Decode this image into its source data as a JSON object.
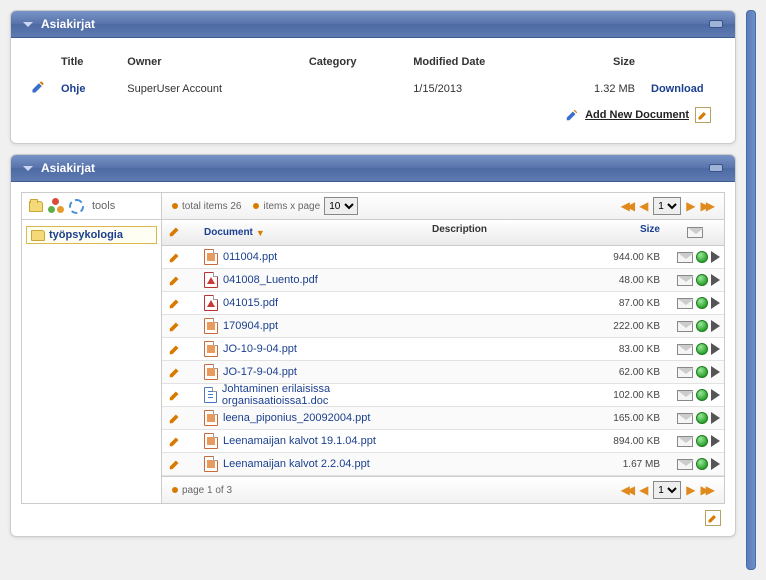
{
  "panel1": {
    "title": "Asiakirjat",
    "columns": {
      "title": "Title",
      "owner": "Owner",
      "category": "Category",
      "modified": "Modified Date",
      "size": "Size"
    },
    "row": {
      "title": "Ohje",
      "owner": "SuperUser Account",
      "category": "",
      "modified": "1/15/2013",
      "size": "1.32 MB",
      "download": "Download"
    },
    "add_new": "Add New Document"
  },
  "panel2": {
    "title": "Asiakirjat",
    "tools_label": "tools",
    "total_items": "total items  26",
    "items_per_page": "items x page",
    "page_size": "10",
    "tree_item": "työpsykologia",
    "headers": {
      "document": "Document",
      "description": "Description",
      "size": "Size"
    },
    "files": [
      {
        "name": "011004.ppt",
        "type": "ppt",
        "size": "944.00 KB"
      },
      {
        "name": "041008_Luento.pdf",
        "type": "pdf",
        "size": "48.00 KB"
      },
      {
        "name": "041015.pdf",
        "type": "pdf",
        "size": "87.00 KB"
      },
      {
        "name": "170904.ppt",
        "type": "ppt",
        "size": "222.00 KB"
      },
      {
        "name": "JO-10-9-04.ppt",
        "type": "ppt",
        "size": "83.00 KB"
      },
      {
        "name": "JO-17-9-04.ppt",
        "type": "ppt",
        "size": "62.00 KB"
      },
      {
        "name": "Johtaminen erilaisissa organisaatioissa1.doc",
        "type": "doc",
        "size": "102.00 KB"
      },
      {
        "name": "leena_piponius_20092004.ppt",
        "type": "ppt",
        "size": "165.00 KB"
      },
      {
        "name": "Leenamaijan kalvot 19.1.04.ppt",
        "type": "ppt",
        "size": "894.00 KB"
      },
      {
        "name": "Leenamaijan kalvot 2.2.04.ppt",
        "type": "ppt",
        "size": "1.67 MB"
      }
    ],
    "page_info": "page 1 of 3",
    "page_selected": "1"
  }
}
